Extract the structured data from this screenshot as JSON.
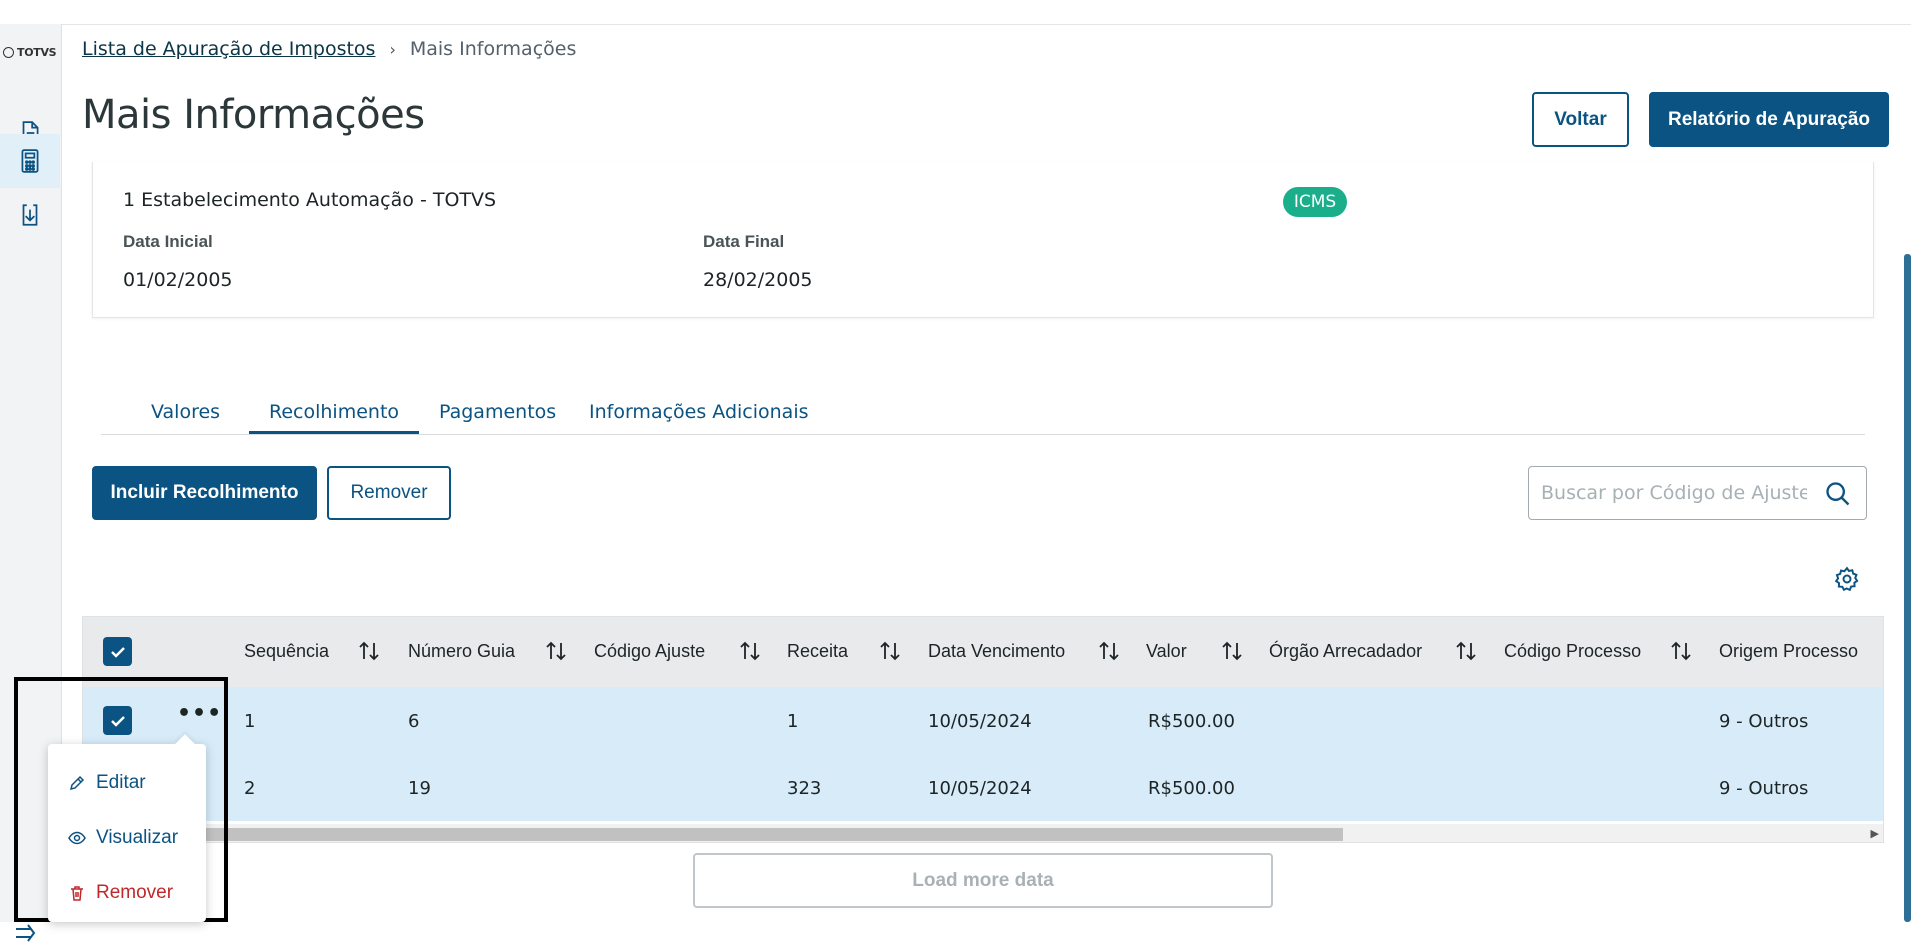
{
  "sidebar": {
    "logo_text": "TOTVS",
    "items": [
      {
        "icon": "document-icon"
      },
      {
        "icon": "calculator-icon",
        "active": true
      },
      {
        "icon": "download-icon"
      }
    ],
    "collapse_icon": "collapse-sidebar-icon"
  },
  "breadcrumb": {
    "parent": "Lista de Apuração de Impostos",
    "current": "Mais Informações"
  },
  "page": {
    "title": "Mais Informações",
    "back_label": "Voltar",
    "report_label": "Relatório de Apuração"
  },
  "info": {
    "establishment": "1 Estabelecimento Automação - TOTVS",
    "tax_tag": "ICMS",
    "start_label": "Data Inicial",
    "start_value": "01/02/2005",
    "end_label": "Data Final",
    "end_value": "28/02/2005"
  },
  "tabs": [
    {
      "label": "Valores",
      "active": false
    },
    {
      "label": "Recolhimento",
      "active": true
    },
    {
      "label": "Pagamentos",
      "active": false
    },
    {
      "label": "Informações Adicionais",
      "active": false
    }
  ],
  "actions": {
    "include_label": "Incluir Recolhimento",
    "remove_label": "Remover"
  },
  "search": {
    "placeholder": "Buscar por Código de Ajuste"
  },
  "table": {
    "columns": [
      "Sequência",
      "Número Guia",
      "Código Ajuste",
      "Receita",
      "Data Vencimento",
      "Valor",
      "Órgão Arrecadador",
      "Código Processo",
      "Origem Processo"
    ],
    "rows": [
      {
        "sequencia": "1",
        "numero_guia": "6",
        "codigo_ajuste": "",
        "receita": "1",
        "data_vencimento": "10/05/2024",
        "valor": "R$500.00",
        "orgao": "",
        "codigo_processo": "",
        "origem_processo": "9 - Outros"
      },
      {
        "sequencia": "2",
        "numero_guia": "19",
        "codigo_ajuste": "",
        "receita": "323",
        "data_vencimento": "10/05/2024",
        "valor": "R$500.00",
        "orgao": "",
        "codigo_processo": "",
        "origem_processo": "9 - Outros"
      }
    ]
  },
  "load_more_label": "Load more data",
  "row_menu": {
    "edit": "Editar",
    "view": "Visualizar",
    "remove": "Remover"
  },
  "colors": {
    "primary": "#0b5382",
    "tag": "#1aaf8a",
    "row_selected": "#d7ecf8",
    "danger": "#c0282b"
  }
}
